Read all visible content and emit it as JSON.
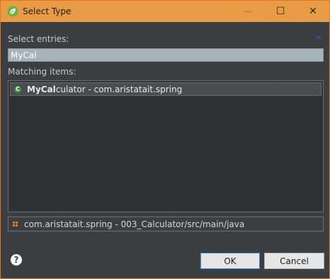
{
  "window": {
    "title": "Select Type",
    "icon": "spring-leaf-icon"
  },
  "titlebar_buttons": {
    "minimize": "—",
    "maximize": "☐",
    "close": "✕"
  },
  "search": {
    "label": "Select entries:",
    "value": "MyCal"
  },
  "matches": {
    "label": "Matching items:",
    "items": [
      {
        "highlight": "MyCal",
        "rest": "culator - com.aristatait.spring",
        "icon": "class-icon"
      }
    ]
  },
  "package_bar": {
    "text": "com.aristatait.spring - 003_Calculator/src/main/java",
    "icon": "package-icon"
  },
  "buttons": {
    "help": "?",
    "ok": "OK",
    "cancel": "Cancel"
  },
  "colors": {
    "titlebar": "#e89a45",
    "background": "#3c3f41",
    "list_background": "#2f3235",
    "input_background": "#a8b2bb"
  }
}
